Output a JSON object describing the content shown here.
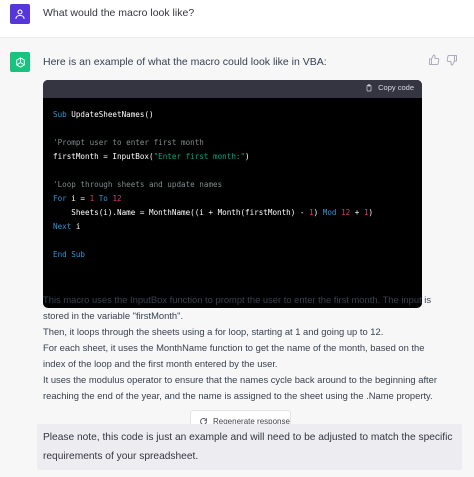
{
  "user_message": {
    "text": "What would the macro look like?"
  },
  "assistant_message": {
    "intro": "Here is an example of what the macro could look like in VBA:",
    "code_block": {
      "copy_label": "Copy code",
      "lines": [
        [
          {
            "t": "Sub",
            "c": "kw"
          },
          {
            "t": " UpdateSheetNames()",
            "c": ""
          }
        ],
        [
          {
            "t": "",
            "c": ""
          }
        ],
        [
          {
            "t": "'Prompt user to enter first month",
            "c": "cm"
          }
        ],
        [
          {
            "t": "firstMonth = InputBox(",
            "c": ""
          },
          {
            "t": "\"Enter first month:\"",
            "c": "st"
          },
          {
            "t": ")",
            "c": ""
          }
        ],
        [
          {
            "t": "",
            "c": ""
          }
        ],
        [
          {
            "t": "'Loop through sheets and update names",
            "c": "cm"
          }
        ],
        [
          {
            "t": "For",
            "c": "kw"
          },
          {
            "t": " i = ",
            "c": ""
          },
          {
            "t": "1",
            "c": "nm"
          },
          {
            "t": " ",
            "c": ""
          },
          {
            "t": "To",
            "c": "kw"
          },
          {
            "t": " ",
            "c": ""
          },
          {
            "t": "12",
            "c": "nm"
          }
        ],
        [
          {
            "t": "    Sheets(i).Name = MonthName((i + Month(firstMonth) - ",
            "c": ""
          },
          {
            "t": "1",
            "c": "nm"
          },
          {
            "t": ") ",
            "c": ""
          },
          {
            "t": "Mod",
            "c": "kw"
          },
          {
            "t": " ",
            "c": ""
          },
          {
            "t": "12",
            "c": "nm"
          },
          {
            "t": " + ",
            "c": ""
          },
          {
            "t": "1",
            "c": "nm"
          },
          {
            "t": ")",
            "c": ""
          }
        ],
        [
          {
            "t": "Next",
            "c": "kw"
          },
          {
            "t": " i",
            "c": ""
          }
        ],
        [
          {
            "t": "",
            "c": ""
          }
        ],
        [
          {
            "t": "End Sub",
            "c": "kw"
          }
        ]
      ]
    },
    "explanation": [
      "This macro uses the InputBox function to prompt the user to enter the first month. The input is stored in the variable \"firstMonth\".",
      "Then, it loops through the sheets using a for loop, starting at 1 and going up to 12.",
      "For each sheet, it uses the MonthName function to get the name of the month, based on the index of the loop and the first month entered by the user.",
      "It uses the modulus operator to ensure that the names cycle back around to the beginning after reaching the end of the year, and the name is assigned to the sheet using the .Name property."
    ],
    "regenerate_label": "Regenerate response",
    "note": "Please note, this code is just an example and will need to be adjusted to match the specific requirements of your spreadsheet."
  },
  "colors": {
    "user_avatar": "#5436da",
    "assistant_avatar": "#19c37d",
    "code_bg": "#000000",
    "code_header_bg": "#343541",
    "keyword": "#2e95d3",
    "comment": "#7f8c8d",
    "string": "#00a67d",
    "number": "#df3079"
  },
  "icons": [
    "user-icon",
    "openai-logo-icon",
    "thumbs-up-icon",
    "thumbs-down-icon",
    "clipboard-icon",
    "refresh-icon"
  ]
}
